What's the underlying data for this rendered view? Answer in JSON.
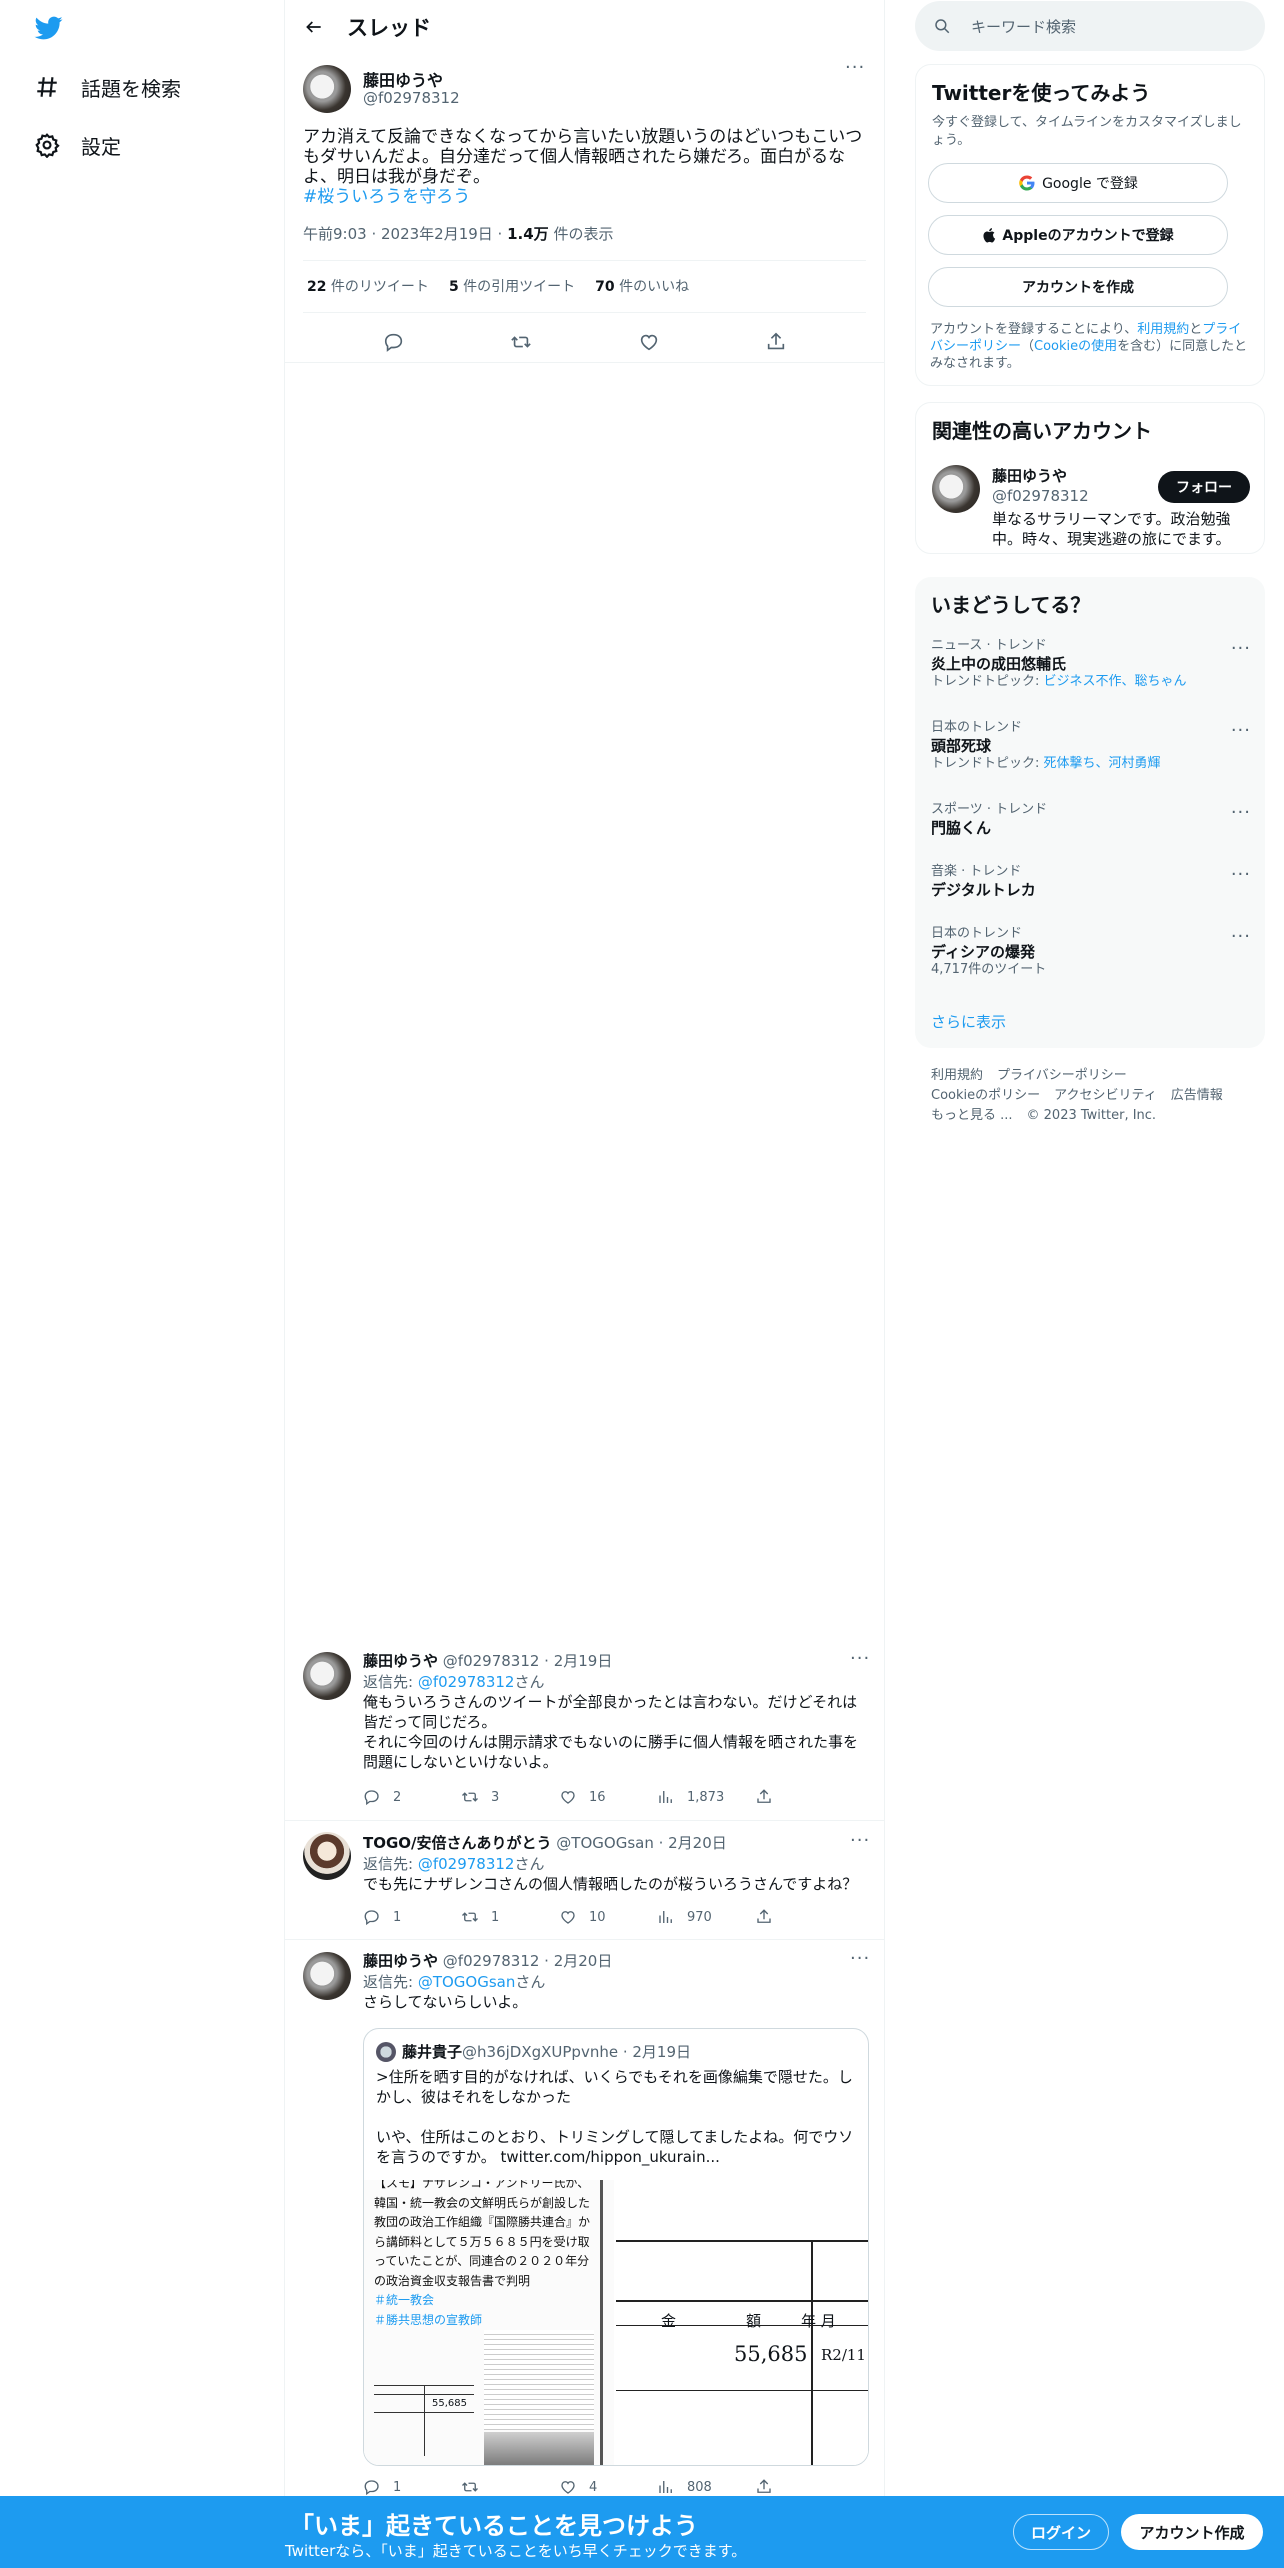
{
  "nav": {
    "explore_label": "話題を検索",
    "settings_label": "設定"
  },
  "header": {
    "title": "スレッド"
  },
  "main_tweet": {
    "name": "藤田ゆうや",
    "handle": "@f02978312",
    "text_line1": "アカ消えて反論できなくなってから言いたい放題いうのはどいつもこいつ",
    "text_line2": "もダサいんだよ。自分達だって個人情報晒されたら嫌だろ。面白がるな",
    "text_line3": "よ、明日は我が身だぞ。",
    "hashtag": "#桜ういろうを守ろう",
    "time": "午前9:03 · 2023年2月19日 · ",
    "views_count": "1.4万",
    "views_label": " 件の表示",
    "retweets_count": "22",
    "retweets_label": " 件のリツイート",
    "quotes_count": "5",
    "quotes_label": " 件の引用ツイート",
    "likes_count": "70",
    "likes_label": " 件のいいね"
  },
  "replies": [
    {
      "name": "藤田ゆうや",
      "meta": " @f02978312 · 2月19日",
      "reply_to_prefix": "返信先: ",
      "reply_to": "@f02978312",
      "reply_to_suffix": "さん",
      "line1": "俺もういろうさんのツイートが全部良かったとは言わない。だけどそれは",
      "line2": "皆だって同じだろ。",
      "line3": "それに今回のけんは開示請求でもないのに勝手に個人情報を晒された事を",
      "line4": "問題にしないといけないよ。",
      "replies": "2",
      "retweets": "3",
      "likes": "16",
      "views": "1,873"
    },
    {
      "name": "TOGO/安倍さんありがとう",
      "meta": " @TOGOGsan · 2月20日",
      "reply_to_prefix": "返信先: ",
      "reply_to": "@f02978312",
      "reply_to_suffix": "さん",
      "line1": "でも先にナザレンコさんの個人情報晒したのが桜ういろうさんですよね？",
      "replies": "1",
      "retweets": "1",
      "likes": "10",
      "views": "970"
    },
    {
      "name": "藤田ゆうや",
      "meta": " @f02978312 · 2月20日",
      "reply_to_prefix": "返信先: ",
      "reply_to": "@TOGOGsan",
      "reply_to_suffix": "さん",
      "line1": "さらしてないらしいよ。",
      "replies": "1",
      "retweets": "",
      "likes": "4",
      "views": "808"
    }
  ],
  "quote": {
    "name": "藤井貴子",
    "meta": " @h36jDXgXUPpvnhe · 2月19日",
    "line1": ">住所を晒す目的がなければ、いくらでもそれを画像編集で隠せた。し",
    "line2": "かし、彼はそれをしなかった",
    "line3": "いや、住所はこのとおり、トリミングして隠してましたよね。何でウソ",
    "line4": "を言うのですか。 twitter.com/hippon_ukurain...",
    "clip_line1": "【スモ】ナザレンコ・アンドリー氏が、",
    "clip_line2": "韓国・統一教会の文鮮明氏らが創設した",
    "clip_line3": "教団の政治工作組織『国際勝共連合』か",
    "clip_line4": "ら講師料として５万５６８５円を受け取",
    "clip_line5": "っていたことが、同連合の２０２０年分",
    "clip_line6": "の政治資金収支報告書で判明",
    "clip_tag1": "＃統一教会",
    "clip_tag2": "＃勝共思想の宣教師",
    "doc_col1": "金",
    "doc_col2": "額",
    "doc_col3": "年 月",
    "doc_amount": "55,685",
    "doc_date": "R2/11",
    "small_amount": "55,685"
  },
  "search": {
    "placeholder": "キーワード検索"
  },
  "signup": {
    "title": "Twitterを使ってみよう",
    "subtitle": "今すぐ登録して、タイムラインをカスタマイズしましょう。",
    "google": "Google で登録",
    "apple": "Appleのアカウントで登録",
    "create": "アカウントを作成",
    "legal_1": "アカウントを登録することにより、",
    "legal_terms": "利用規約",
    "legal_2": "と",
    "legal_privacy": "プライバシーポリシー",
    "legal_3": "（",
    "legal_cookie": "Cookieの使用",
    "legal_4": "を含む）に同意したとみなされます。"
  },
  "related": {
    "title": "関連性の高いアカウント",
    "name": "藤田ゆうや",
    "handle": "@f02978312",
    "follow": "フォロー",
    "bio": "単なるサラリーマンです。政治勉強中。時々、現実逃避の旅にでます。"
  },
  "trends": {
    "title": "いまどうしてる？",
    "items": [
      {
        "context": "ニュース · トレンド",
        "title": "炎上中の成田悠輔氏",
        "topic_prefix": "トレンドトピック: ",
        "topic": "ビジネス不作、聡ちゃん"
      },
      {
        "context": "日本のトレンド",
        "title": "頭部死球",
        "topic_prefix": "トレンドトピック: ",
        "topic": "死体撃ち、河村勇輝"
      },
      {
        "context": "スポーツ · トレンド",
        "title": "門脇くん"
      },
      {
        "context": "音楽 · トレンド",
        "title": "デジタルトレカ"
      },
      {
        "context": "日本のトレンド",
        "title": "ディシアの爆発",
        "count": "4,717件のツイート"
      }
    ],
    "show_more": "さらに表示"
  },
  "footer": {
    "terms": "利用規約",
    "privacy": "プライバシーポリシー",
    "cookie": "Cookieのポリシー",
    "accessibility": "アクセシビリティ",
    "ads": "広告情報",
    "more": "もっと見る ...",
    "copyright": "© 2023 Twitter, Inc."
  },
  "banner": {
    "title": "「いま」起きていることを見つけよう",
    "subtitle": "Twitterなら、「いま」起きていることをいち早くチェックできます。",
    "login": "ログイン",
    "create": "アカウント作成"
  },
  "colors": {
    "accent": "#1d9bf0",
    "text": "#0f1419",
    "secondary": "#536471",
    "border": "#eff3f4"
  }
}
